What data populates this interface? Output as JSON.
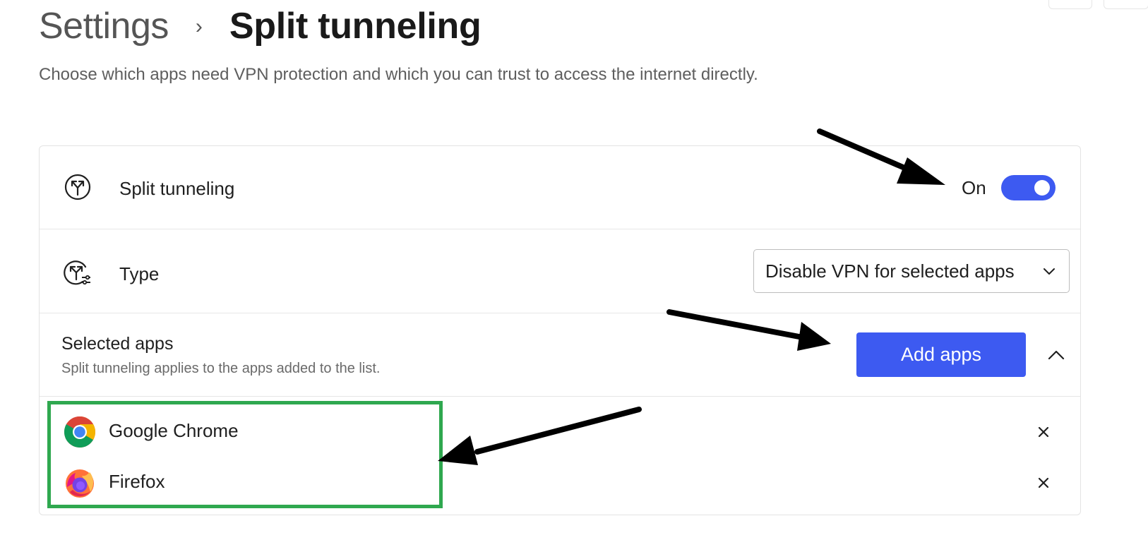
{
  "breadcrumb": {
    "root": "Settings",
    "separator": "›",
    "current": "Split tunneling"
  },
  "description": "Choose which apps need VPN protection and which you can trust to access the internet directly.",
  "split_tunneling": {
    "icon": "split-route-icon",
    "label": "Split tunneling",
    "state_label": "On",
    "enabled": true
  },
  "type": {
    "icon": "split-settings-icon",
    "label": "Type",
    "selected": "Disable VPN for selected apps"
  },
  "selected_apps": {
    "title": "Selected apps",
    "subtitle": "Split tunneling applies to the apps added to the list.",
    "add_button": "Add apps",
    "collapse_icon": "chevron-up-icon",
    "apps": [
      {
        "name": "Google Chrome",
        "icon": "chrome-icon"
      },
      {
        "name": "Firefox",
        "icon": "firefox-icon"
      }
    ]
  },
  "colors": {
    "accent": "#3d5af1",
    "highlight": "#2fa84f",
    "annotation_arrow": "#000000"
  }
}
